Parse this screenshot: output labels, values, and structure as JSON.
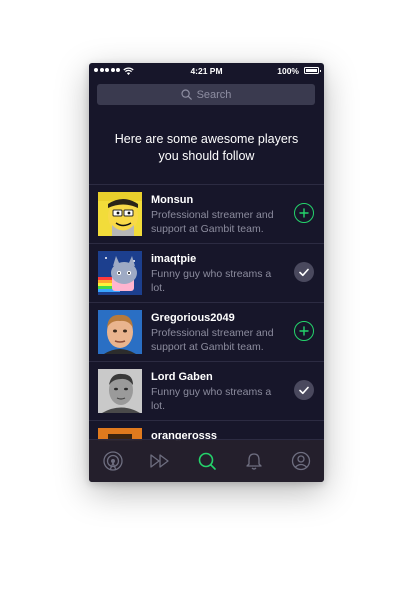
{
  "status_bar": {
    "time": "4:21 PM",
    "battery": "100%"
  },
  "search": {
    "placeholder": "Search",
    "icon": "search-icon"
  },
  "headline": {
    "line1": "Here are some awesome players",
    "line2": "you should follow"
  },
  "players": [
    {
      "name": "Monsun",
      "description": "Professional streamer and support at Gambit team.",
      "state": "follow"
    },
    {
      "name": "imaqtpie",
      "description": "Funny guy who streams a lot.",
      "state": "following"
    },
    {
      "name": "Gregorious2049",
      "description": "Professional streamer and support at Gambit team.",
      "state": "follow"
    },
    {
      "name": "Lord Gaben",
      "description": "Funny guy who streams a lot.",
      "state": "following"
    },
    {
      "name": "orangerosss",
      "description": "",
      "state": "following"
    }
  ],
  "tabbar": {
    "tabs": [
      {
        "icon": "broadcast-icon"
      },
      {
        "icon": "play-forward-icon"
      },
      {
        "icon": "search-icon",
        "active": true
      },
      {
        "icon": "bell-icon"
      },
      {
        "icon": "profile-icon"
      }
    ]
  },
  "colors": {
    "background": "#17162a",
    "accent": "#24d36b",
    "muted_text": "#8c8c9e",
    "search_bg": "#3a3a4f"
  }
}
